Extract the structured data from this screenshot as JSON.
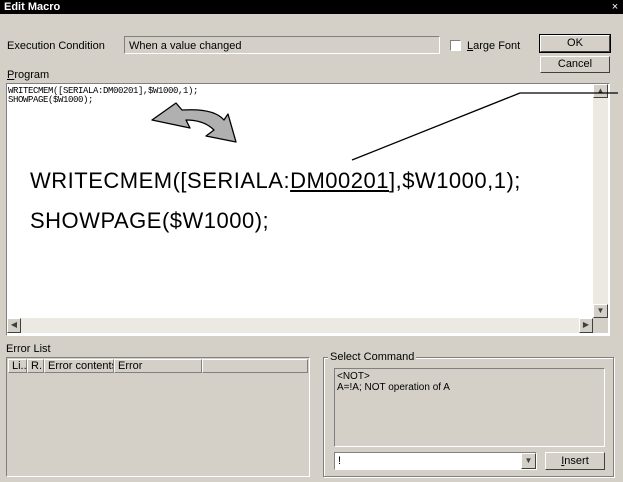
{
  "window": {
    "title": "Edit Macro",
    "close_glyph": "×"
  },
  "condition": {
    "label": "Execution Condition",
    "value": "When a value changed"
  },
  "large_font": {
    "label": "Large Font",
    "checked": false
  },
  "buttons": {
    "ok": "OK",
    "cancel": "Cancel",
    "insert": "Insert"
  },
  "program": {
    "label": "Program",
    "lines": [
      "WRITECMEM([SERIALA:DM00201],$W1000,1);",
      "SHOWPAGE($W1000);"
    ]
  },
  "zoom": {
    "line1_pre": "WRITECMEM([SERIALA:",
    "line1_device": "DM00201",
    "line1_post": "],$W1000,1);",
    "line2": "SHOWPAGE($W1000);"
  },
  "error_list": {
    "label": "Error List",
    "columns": [
      "Li..",
      "R..",
      "Error contents",
      "Error",
      ""
    ]
  },
  "select_command": {
    "label": "Select Command",
    "description": "<NOT>\nA=!A; NOT operation of A",
    "selected": "!"
  },
  "colors": {
    "titlebar": "#000000",
    "dialog": "#d4d0c8",
    "arrow_fill": "#b0b0b0"
  }
}
